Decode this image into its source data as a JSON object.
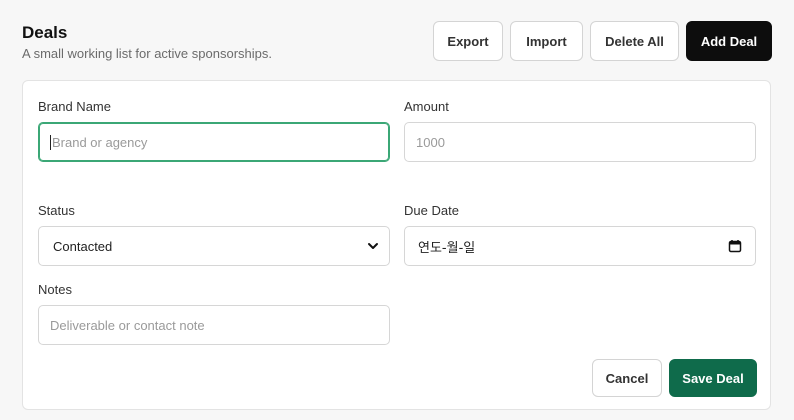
{
  "header": {
    "title": "Deals",
    "subtitle": "A small working list for active sponsorships.",
    "buttons": {
      "export": "Export",
      "import": "Import",
      "delete_all": "Delete All",
      "add_deal": "Add Deal"
    }
  },
  "form": {
    "brand": {
      "label": "Brand Name",
      "placeholder": "Brand or agency",
      "value": ""
    },
    "amount": {
      "label": "Amount",
      "placeholder": "1000",
      "value": ""
    },
    "status": {
      "label": "Status",
      "value": "Contacted"
    },
    "due_date": {
      "label": "Due Date",
      "value": "연도-월-일"
    },
    "notes": {
      "label": "Notes",
      "placeholder": "Deliverable or contact note",
      "value": ""
    },
    "actions": {
      "cancel": "Cancel",
      "save": "Save Deal"
    }
  },
  "colors": {
    "primary": "#0d0d0d",
    "save": "#0f6b4b",
    "focus": "#3ba776"
  },
  "icons": {
    "status": "chevron-down-icon",
    "due_date": "calendar-icon"
  }
}
